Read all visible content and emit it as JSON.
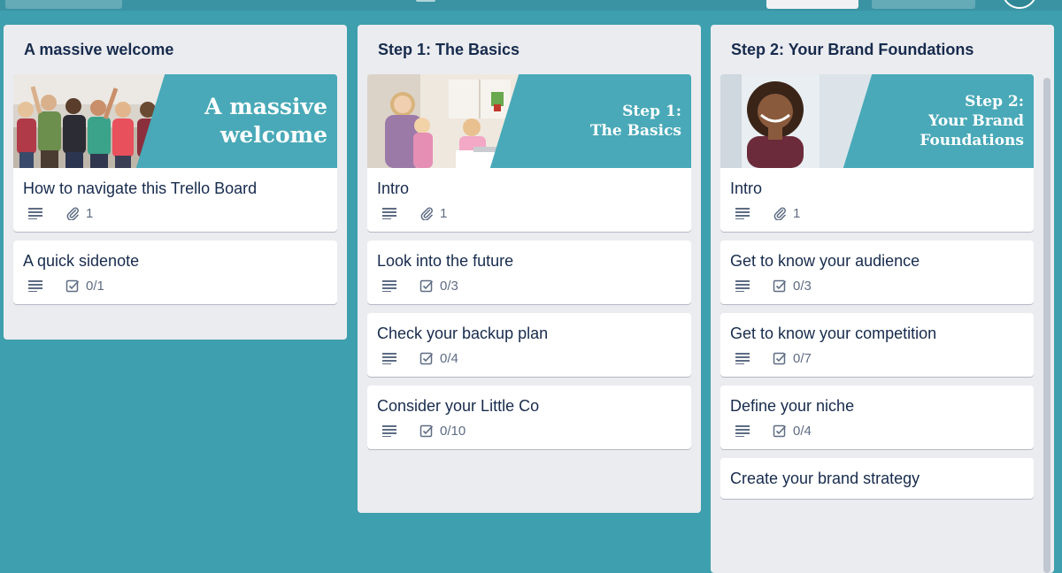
{
  "colors": {
    "board": "#3e9fae",
    "cover_teal": "#49a9b8",
    "list_bg": "#ebecf0",
    "text": "#172b4d",
    "badge": "#5e6c84"
  },
  "lists": [
    {
      "title": "A massive welcome",
      "cover": {
        "text": "A massive\nwelcome",
        "photo_icon": "group-of-women-photo"
      },
      "cards": [
        {
          "title": "How to navigate this Trello Board",
          "badge_type": "attachment",
          "badge_value": "1"
        },
        {
          "title": "A quick sidenote",
          "badge_type": "checklist",
          "badge_value": "0/1"
        }
      ]
    },
    {
      "title": "Step 1: The Basics",
      "cover": {
        "text": "Step 1:\nThe Basics",
        "photo_icon": "mother-and-children-photo"
      },
      "cards": [
        {
          "title": "Intro",
          "badge_type": "attachment",
          "badge_value": "1"
        },
        {
          "title": "Look into the future",
          "badge_type": "checklist",
          "badge_value": "0/3"
        },
        {
          "title": "Check your backup plan",
          "badge_type": "checklist",
          "badge_value": "0/4"
        },
        {
          "title": "Consider your Little Co",
          "badge_type": "checklist",
          "badge_value": "0/10"
        }
      ]
    },
    {
      "title": "Step 2: Your Brand Foundations",
      "cover": {
        "text": "Step 2:\nYour Brand\nFoundations",
        "photo_icon": "smiling-woman-photo"
      },
      "cards": [
        {
          "title": "Intro",
          "badge_type": "attachment",
          "badge_value": "1"
        },
        {
          "title": "Get to know your audience",
          "badge_type": "checklist",
          "badge_value": "0/3"
        },
        {
          "title": "Get to know your competition",
          "badge_type": "checklist",
          "badge_value": "0/7"
        },
        {
          "title": "Define your niche",
          "badge_type": "checklist",
          "badge_value": "0/4"
        },
        {
          "title": "Create your brand strategy",
          "badge_type": "checklist",
          "badge_value": ""
        }
      ]
    }
  ]
}
